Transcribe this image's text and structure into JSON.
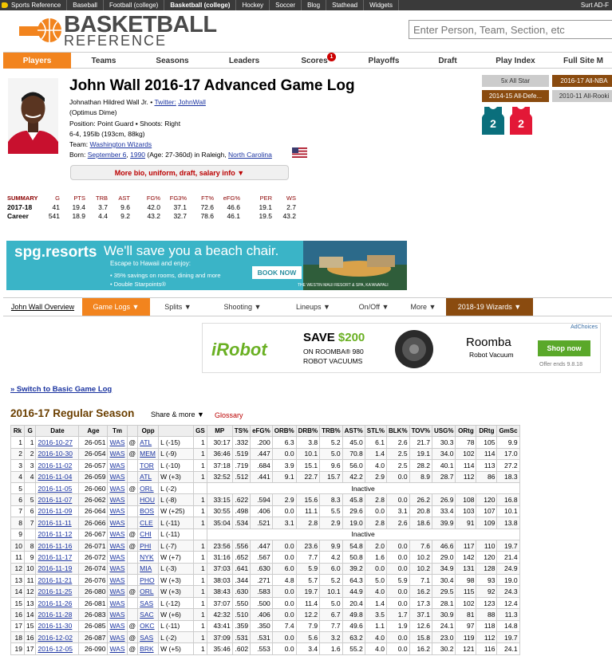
{
  "topbar": {
    "items": [
      "Sports Reference",
      "Baseball",
      "Football (college)",
      "Basketball (college)",
      "Hockey",
      "Soccer",
      "Blog",
      "Stathead",
      "Widgets"
    ],
    "right": "Surt AD-F"
  },
  "logo": {
    "line1": "BASKETBALL",
    "line2": "REFERENCE"
  },
  "search": {
    "placeholder": "Enter Person, Team, Section, etc"
  },
  "nav": {
    "items": [
      "Players",
      "Teams",
      "Seasons",
      "Leaders",
      "Scores",
      "Playoffs",
      "Draft",
      "Play Index",
      "Full Site M"
    ],
    "badge": "1"
  },
  "player": {
    "title": "John Wall 2016-17 Advanced Game Log",
    "fullname": "Johnathan Hildred Wall Jr.",
    "twitter_label": "Twitter:",
    "twitter_handle": "JohnWall",
    "nickname": "(Optimus Dime)",
    "position": "Position: Point Guard",
    "shoots": "Shoots: Right",
    "size": "6-4, 195lb (193cm, 88kg)",
    "team_label": "Team:",
    "team": "Washington Wizards",
    "born_label": "Born:",
    "born_date": "September 6",
    "born_year": "1990",
    "born_age": "(Age: 27-360d) in Raleigh,",
    "born_state": "North Carolina",
    "more_bio": "More bio, uniform, draft, salary info ▼"
  },
  "awards": [
    "5x All Star",
    "2016-17 All-NBA",
    "2014-15 All-Defe...",
    "2010-11 All-Rooki"
  ],
  "jerseys": [
    "2",
    "2"
  ],
  "colors": {
    "accent": "#f2841e",
    "brand_dark": "#8a4b0f",
    "link": "#1a33a0",
    "wizards_red": "#e31837",
    "wizards_teal": "#0a6f7c"
  },
  "summary": {
    "headers": [
      "SUMMARY",
      "G",
      "PTS",
      "TRB",
      "AST",
      "FG%",
      "FG3%",
      "FT%",
      "eFG%",
      "PER",
      "WS"
    ],
    "rows": [
      [
        "2017-18",
        "41",
        "19.4",
        "3.7",
        "9.6",
        "42.0",
        "37.1",
        "72.6",
        "46.6",
        "19.1",
        "2.7"
      ],
      [
        "Career",
        "541",
        "18.9",
        "4.4",
        "9.2",
        "43.2",
        "32.7",
        "78.6",
        "46.1",
        "19.5",
        "43.2"
      ]
    ]
  },
  "spg_ad": {
    "brand": "spg.resorts",
    "headline": "We'll save you a beach chair.",
    "sub": "Escape to Hawaii and enjoy:",
    "bullet1": "• 35% savings on rooms, dining and more",
    "bullet2": "• Double Starpoints®",
    "cta": "BOOK NOW",
    "footer": "THE WESTIN MAUI RESORT & SPA, KA'ANAPALI"
  },
  "subnav": {
    "items": [
      "John Wall Overview",
      "Game Logs ▼",
      "Splits ▼",
      "Shooting ▼",
      "Lineups ▼",
      "On/Off ▼",
      "More ▼",
      "2018-19 Wizards ▼"
    ]
  },
  "roomba_ad": {
    "adchoices": "AdChoices",
    "irobot": "iRobot",
    "save": "SAVE",
    "amount": "$200",
    "on": "ON ROOMBA® 980",
    "robot": "ROBOT VACUUMS",
    "roomba": "Roomba",
    "robot_vacuum": "Robot Vacuum",
    "shop": "Shop now",
    "offer": "Offer ends 9.8.18"
  },
  "switch_link": "» Switch to Basic Game Log",
  "season_header": "2016-17 Regular Season",
  "share": "Share & more ▼",
  "glossary": "Glossary",
  "table": {
    "headers": [
      "Rk",
      "G",
      "Date",
      "Age",
      "Tm",
      "",
      "Opp",
      "",
      "GS",
      "MP",
      "TS%",
      "eFG%",
      "ORB%",
      "DRB%",
      "TRB%",
      "AST%",
      "STL%",
      "BLK%",
      "TOV%",
      "USG%",
      "ORtg",
      "DRtg",
      "GmSc"
    ],
    "rows": [
      [
        "1",
        "1",
        "2016-10-27",
        "26-051",
        "WAS",
        "@",
        "ATL",
        "L (-15)",
        "1",
        "30:17",
        ".332",
        ".200",
        "6.3",
        "3.8",
        "5.2",
        "45.0",
        "6.1",
        "2.6",
        "21.7",
        "30.3",
        "78",
        "105",
        "9.9"
      ],
      [
        "2",
        "2",
        "2016-10-30",
        "26-054",
        "WAS",
        "@",
        "MEM",
        "L (-9)",
        "1",
        "36:46",
        ".519",
        ".447",
        "0.0",
        "10.1",
        "5.0",
        "70.8",
        "1.4",
        "2.5",
        "19.1",
        "34.0",
        "102",
        "114",
        "17.0"
      ],
      [
        "3",
        "3",
        "2016-11-02",
        "26-057",
        "WAS",
        "",
        "TOR",
        "L (-10)",
        "1",
        "37:18",
        ".719",
        ".684",
        "3.9",
        "15.1",
        "9.6",
        "56.0",
        "4.0",
        "2.5",
        "28.2",
        "40.1",
        "114",
        "113",
        "27.2"
      ],
      [
        "4",
        "4",
        "2016-11-04",
        "26-059",
        "WAS",
        "",
        "ATL",
        "W (+3)",
        "1",
        "32:52",
        ".512",
        ".441",
        "9.1",
        "22.7",
        "15.7",
        "42.2",
        "2.9",
        "0.0",
        "8.9",
        "28.7",
        "112",
        "86",
        "18.3"
      ],
      [
        "5",
        "",
        "2016-11-05",
        "26-060",
        "WAS",
        "@",
        "ORL",
        "L (-2)",
        "",
        "Inactive"
      ],
      [
        "6",
        "5",
        "2016-11-07",
        "26-062",
        "WAS",
        "",
        "HOU",
        "L (-8)",
        "1",
        "33:15",
        ".622",
        ".594",
        "2.9",
        "15.6",
        "8.3",
        "45.8",
        "2.8",
        "0.0",
        "26.2",
        "26.9",
        "108",
        "120",
        "16.8"
      ],
      [
        "7",
        "6",
        "2016-11-09",
        "26-064",
        "WAS",
        "",
        "BOS",
        "W (+25)",
        "1",
        "30:55",
        ".498",
        ".406",
        "0.0",
        "11.1",
        "5.5",
        "29.6",
        "0.0",
        "3.1",
        "20.8",
        "33.4",
        "103",
        "107",
        "10.1"
      ],
      [
        "8",
        "7",
        "2016-11-11",
        "26-066",
        "WAS",
        "",
        "CLE",
        "L (-11)",
        "1",
        "35:04",
        ".534",
        ".521",
        "3.1",
        "2.8",
        "2.9",
        "19.0",
        "2.8",
        "2.6",
        "18.6",
        "39.9",
        "91",
        "109",
        "13.8"
      ],
      [
        "9",
        "",
        "2016-11-12",
        "26-067",
        "WAS",
        "@",
        "CHI",
        "L (-11)",
        "",
        "Inactive"
      ],
      [
        "10",
        "8",
        "2016-11-16",
        "26-071",
        "WAS",
        "@",
        "PHI",
        "L (-7)",
        "1",
        "23:56",
        ".556",
        ".447",
        "0.0",
        "23.6",
        "9.9",
        "54.8",
        "2.0",
        "0.0",
        "7.6",
        "46.6",
        "117",
        "110",
        "19.7"
      ],
      [
        "11",
        "9",
        "2016-11-17",
        "26-072",
        "WAS",
        "",
        "NYK",
        "W (+7)",
        "1",
        "31:16",
        ".652",
        ".567",
        "0.0",
        "7.7",
        "4.2",
        "50.8",
        "1.6",
        "0.0",
        "10.2",
        "29.0",
        "142",
        "120",
        "21.4"
      ],
      [
        "12",
        "10",
        "2016-11-19",
        "26-074",
        "WAS",
        "",
        "MIA",
        "L (-3)",
        "1",
        "37:03",
        ".641",
        ".630",
        "6.0",
        "5.9",
        "6.0",
        "39.2",
        "0.0",
        "0.0",
        "10.2",
        "34.9",
        "131",
        "128",
        "24.9"
      ],
      [
        "13",
        "11",
        "2016-11-21",
        "26-076",
        "WAS",
        "",
        "PHO",
        "W (+3)",
        "1",
        "38:03",
        ".344",
        ".271",
        "4.8",
        "5.7",
        "5.2",
        "64.3",
        "5.0",
        "5.9",
        "7.1",
        "30.4",
        "98",
        "93",
        "19.0"
      ],
      [
        "14",
        "12",
        "2016-11-25",
        "26-080",
        "WAS",
        "@",
        "ORL",
        "W (+3)",
        "1",
        "38:43",
        ".630",
        ".583",
        "0.0",
        "19.7",
        "10.1",
        "44.9",
        "4.0",
        "0.0",
        "16.2",
        "29.5",
        "115",
        "92",
        "24.3"
      ],
      [
        "15",
        "13",
        "2016-11-26",
        "26-081",
        "WAS",
        "",
        "SAS",
        "L (-12)",
        "1",
        "37:07",
        ".550",
        ".500",
        "0.0",
        "11.4",
        "5.0",
        "20.4",
        "1.4",
        "0.0",
        "17.3",
        "28.1",
        "102",
        "123",
        "12.4"
      ],
      [
        "16",
        "14",
        "2016-11-28",
        "26-083",
        "WAS",
        "",
        "SAC",
        "W (+6)",
        "1",
        "42:32",
        ".510",
        ".406",
        "0.0",
        "12.2",
        "6.7",
        "49.8",
        "3.5",
        "1.7",
        "37.1",
        "30.9",
        "81",
        "88",
        "11.3"
      ],
      [
        "17",
        "15",
        "2016-11-30",
        "26-085",
        "WAS",
        "@",
        "OKC",
        "L (-11)",
        "1",
        "43:41",
        ".359",
        ".350",
        "7.4",
        "7.9",
        "7.7",
        "49.6",
        "1.1",
        "1.9",
        "12.6",
        "24.1",
        "97",
        "118",
        "14.8"
      ],
      [
        "18",
        "16",
        "2016-12-02",
        "26-087",
        "WAS",
        "@",
        "SAS",
        "L (-2)",
        "1",
        "37:09",
        ".531",
        ".531",
        "0.0",
        "5.6",
        "3.2",
        "63.2",
        "4.0",
        "0.0",
        "15.8",
        "23.0",
        "119",
        "112",
        "19.7"
      ],
      [
        "19",
        "17",
        "2016-12-05",
        "26-090",
        "WAS",
        "@",
        "BRK",
        "W (+5)",
        "1",
        "35:46",
        ".602",
        ".553",
        "0.0",
        "3.4",
        "1.6",
        "55.2",
        "4.0",
        "0.0",
        "16.2",
        "30.2",
        "121",
        "116",
        "24.1"
      ]
    ],
    "links": {
      "date": true,
      "team": true,
      "opp": true
    }
  }
}
